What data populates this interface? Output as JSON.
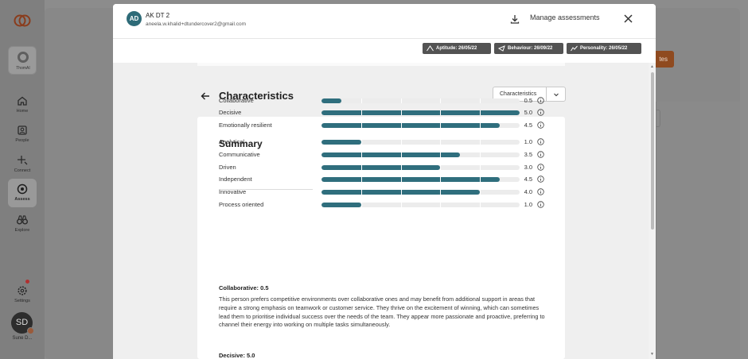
{
  "sidebar": {
    "org_label": "ThomAI",
    "items": [
      {
        "label": "Home",
        "icon": "home-icon"
      },
      {
        "label": "People",
        "icon": "people-icon"
      },
      {
        "label": "Connect",
        "icon": "connect-icon"
      },
      {
        "label": "Assess",
        "icon": "assess-icon",
        "active": true
      },
      {
        "label": "Explore",
        "icon": "binoculars-icon"
      }
    ],
    "settings_label": "Settings",
    "user_initials": "SD",
    "user_name": "Sune D..."
  },
  "background": {
    "button_label": "tes"
  },
  "modal": {
    "avatar_initials": "AD",
    "name": "AK DT 2",
    "email": "aneela.w.khalid+dtundercover2@gmail.com",
    "manage_label": "Manage assessments",
    "tags": [
      {
        "label": "Aptitude: 26/05/22",
        "icon": "aptitude-icon"
      },
      {
        "label": "Behaviour: 26/09/22",
        "icon": "behaviour-icon"
      },
      {
        "label": "Personality: 26/05/22",
        "icon": "personality-icon"
      }
    ],
    "page_title": "Characteristics",
    "select_value": "Characteristics"
  },
  "summary": {
    "title": "Summary",
    "max": 5,
    "rows": [
      {
        "label": "Collaborative",
        "value": 0.5,
        "display": "0.5"
      },
      {
        "label": "Decisive",
        "value": 5.0,
        "display": "5.0"
      },
      {
        "label": "Emotionally resilient",
        "value": 4.5,
        "display": "4.5"
      },
      {
        "label": "Analytical",
        "value": 1.0,
        "display": "1.0"
      },
      {
        "label": "Communicative",
        "value": 3.5,
        "display": "3.5"
      },
      {
        "label": "Driven",
        "value": 3.0,
        "display": "3.0"
      },
      {
        "label": "Independent",
        "value": 4.5,
        "display": "4.5"
      },
      {
        "label": "Innovative",
        "value": 4.0,
        "display": "4.0"
      },
      {
        "label": "Process oriented",
        "value": 1.0,
        "display": "1.0"
      }
    ]
  },
  "detail": {
    "title": "Collaborative: 0.5",
    "text": "This person prefers competitive environments over collaborative ones and may benefit from additional support in areas that require a strong emphasis on teamwork or customer service. They thrive on the excitement of winning, which can sometimes lead them to prioritise individual success over the needs of the team. They appear more passionate and proactive, preferring to channel their energy into working on multiple tasks simultaneously.",
    "next_title": "Decisive: 5.0"
  },
  "colors": {
    "bar": "#2f6e7d",
    "avatar": "#2e6b78",
    "tag": "#535353"
  }
}
